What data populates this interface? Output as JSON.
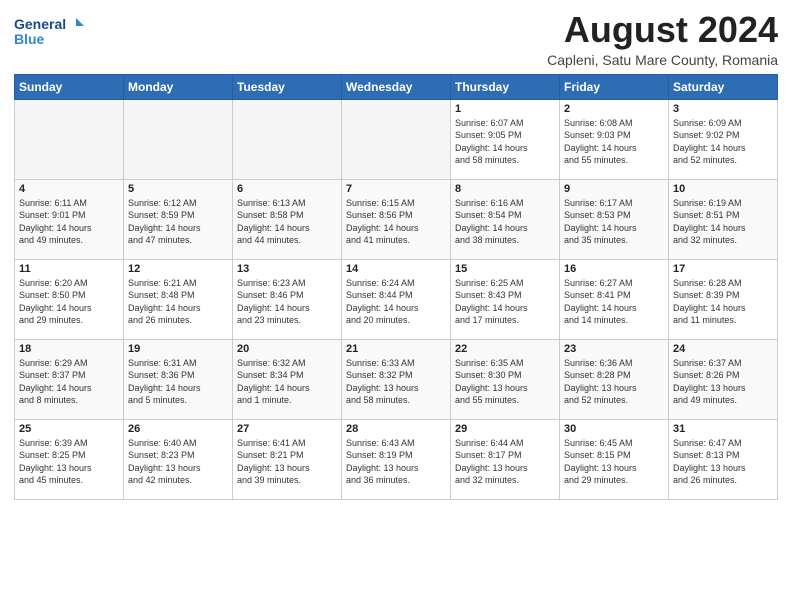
{
  "header": {
    "logo_line1": "General",
    "logo_line2": "Blue",
    "title": "August 2024",
    "subtitle": "Capleni, Satu Mare County, Romania"
  },
  "weekdays": [
    "Sunday",
    "Monday",
    "Tuesday",
    "Wednesday",
    "Thursday",
    "Friday",
    "Saturday"
  ],
  "weeks": [
    [
      {
        "day": "",
        "info": ""
      },
      {
        "day": "",
        "info": ""
      },
      {
        "day": "",
        "info": ""
      },
      {
        "day": "",
        "info": ""
      },
      {
        "day": "1",
        "info": "Sunrise: 6:07 AM\nSunset: 9:05 PM\nDaylight: 14 hours\nand 58 minutes."
      },
      {
        "day": "2",
        "info": "Sunrise: 6:08 AM\nSunset: 9:03 PM\nDaylight: 14 hours\nand 55 minutes."
      },
      {
        "day": "3",
        "info": "Sunrise: 6:09 AM\nSunset: 9:02 PM\nDaylight: 14 hours\nand 52 minutes."
      }
    ],
    [
      {
        "day": "4",
        "info": "Sunrise: 6:11 AM\nSunset: 9:01 PM\nDaylight: 14 hours\nand 49 minutes."
      },
      {
        "day": "5",
        "info": "Sunrise: 6:12 AM\nSunset: 8:59 PM\nDaylight: 14 hours\nand 47 minutes."
      },
      {
        "day": "6",
        "info": "Sunrise: 6:13 AM\nSunset: 8:58 PM\nDaylight: 14 hours\nand 44 minutes."
      },
      {
        "day": "7",
        "info": "Sunrise: 6:15 AM\nSunset: 8:56 PM\nDaylight: 14 hours\nand 41 minutes."
      },
      {
        "day": "8",
        "info": "Sunrise: 6:16 AM\nSunset: 8:54 PM\nDaylight: 14 hours\nand 38 minutes."
      },
      {
        "day": "9",
        "info": "Sunrise: 6:17 AM\nSunset: 8:53 PM\nDaylight: 14 hours\nand 35 minutes."
      },
      {
        "day": "10",
        "info": "Sunrise: 6:19 AM\nSunset: 8:51 PM\nDaylight: 14 hours\nand 32 minutes."
      }
    ],
    [
      {
        "day": "11",
        "info": "Sunrise: 6:20 AM\nSunset: 8:50 PM\nDaylight: 14 hours\nand 29 minutes."
      },
      {
        "day": "12",
        "info": "Sunrise: 6:21 AM\nSunset: 8:48 PM\nDaylight: 14 hours\nand 26 minutes."
      },
      {
        "day": "13",
        "info": "Sunrise: 6:23 AM\nSunset: 8:46 PM\nDaylight: 14 hours\nand 23 minutes."
      },
      {
        "day": "14",
        "info": "Sunrise: 6:24 AM\nSunset: 8:44 PM\nDaylight: 14 hours\nand 20 minutes."
      },
      {
        "day": "15",
        "info": "Sunrise: 6:25 AM\nSunset: 8:43 PM\nDaylight: 14 hours\nand 17 minutes."
      },
      {
        "day": "16",
        "info": "Sunrise: 6:27 AM\nSunset: 8:41 PM\nDaylight: 14 hours\nand 14 minutes."
      },
      {
        "day": "17",
        "info": "Sunrise: 6:28 AM\nSunset: 8:39 PM\nDaylight: 14 hours\nand 11 minutes."
      }
    ],
    [
      {
        "day": "18",
        "info": "Sunrise: 6:29 AM\nSunset: 8:37 PM\nDaylight: 14 hours\nand 8 minutes."
      },
      {
        "day": "19",
        "info": "Sunrise: 6:31 AM\nSunset: 8:36 PM\nDaylight: 14 hours\nand 5 minutes."
      },
      {
        "day": "20",
        "info": "Sunrise: 6:32 AM\nSunset: 8:34 PM\nDaylight: 14 hours\nand 1 minute."
      },
      {
        "day": "21",
        "info": "Sunrise: 6:33 AM\nSunset: 8:32 PM\nDaylight: 13 hours\nand 58 minutes."
      },
      {
        "day": "22",
        "info": "Sunrise: 6:35 AM\nSunset: 8:30 PM\nDaylight: 13 hours\nand 55 minutes."
      },
      {
        "day": "23",
        "info": "Sunrise: 6:36 AM\nSunset: 8:28 PM\nDaylight: 13 hours\nand 52 minutes."
      },
      {
        "day": "24",
        "info": "Sunrise: 6:37 AM\nSunset: 8:26 PM\nDaylight: 13 hours\nand 49 minutes."
      }
    ],
    [
      {
        "day": "25",
        "info": "Sunrise: 6:39 AM\nSunset: 8:25 PM\nDaylight: 13 hours\nand 45 minutes."
      },
      {
        "day": "26",
        "info": "Sunrise: 6:40 AM\nSunset: 8:23 PM\nDaylight: 13 hours\nand 42 minutes."
      },
      {
        "day": "27",
        "info": "Sunrise: 6:41 AM\nSunset: 8:21 PM\nDaylight: 13 hours\nand 39 minutes."
      },
      {
        "day": "28",
        "info": "Sunrise: 6:43 AM\nSunset: 8:19 PM\nDaylight: 13 hours\nand 36 minutes."
      },
      {
        "day": "29",
        "info": "Sunrise: 6:44 AM\nSunset: 8:17 PM\nDaylight: 13 hours\nand 32 minutes."
      },
      {
        "day": "30",
        "info": "Sunrise: 6:45 AM\nSunset: 8:15 PM\nDaylight: 13 hours\nand 29 minutes."
      },
      {
        "day": "31",
        "info": "Sunrise: 6:47 AM\nSunset: 8:13 PM\nDaylight: 13 hours\nand 26 minutes."
      }
    ]
  ]
}
